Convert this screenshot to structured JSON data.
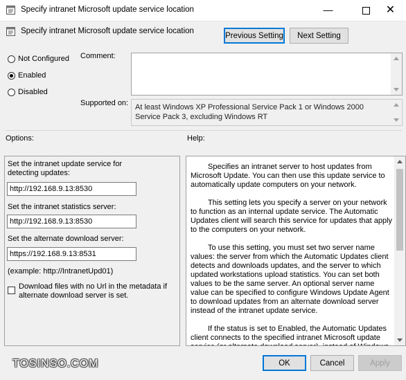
{
  "window": {
    "title": "Specify intranet Microsoft update service location",
    "minimize_icon": "minimize-icon",
    "maximize_icon": "maximize-icon",
    "close_icon": "close-icon"
  },
  "header": {
    "title": "Specify intranet Microsoft update service location",
    "previous_setting": "Previous Setting",
    "next_setting": "Next Setting"
  },
  "state": {
    "options": [
      {
        "label": "Not Configured",
        "checked": false
      },
      {
        "label": "Enabled",
        "checked": true
      },
      {
        "label": "Disabled",
        "checked": false
      }
    ]
  },
  "comment": {
    "label": "Comment:",
    "value": ""
  },
  "supported_on": {
    "label": "Supported on:",
    "value": "At least Windows XP Professional Service Pack 1 or Windows 2000 Service Pack 3, excluding Windows RT"
  },
  "options_section": {
    "label": "Options:",
    "detect_label": "Set the intranet update service for detecting updates:",
    "detect_value": "http://192.168.9.13:8530",
    "stats_label": "Set the intranet statistics server:",
    "stats_value": "http://192.168.9.13:8530",
    "alt_label": "Set the alternate download server:",
    "alt_value": "https://192.168.9.13:8531",
    "example": "(example: http://IntranetUpd01)",
    "checkbox_label": "Download files with no Url in the metadata if alternate download server is set.",
    "checkbox_checked": false
  },
  "help_section": {
    "label": "Help:",
    "paragraphs": [
      "Specifies an intranet server to host updates from Microsoft Update. You can then use this update service to automatically update computers on your network.",
      "This setting lets you specify a server on your network to function as an internal update service. The Automatic Updates client will search this service for updates that apply to the computers on your network.",
      "To use this setting, you must set two server name values: the server from which the Automatic Updates client detects and downloads updates, and the server to which updated workstations upload statistics. You can set both values to be the same server. An optional server name value can be specified to configure Windows Update Agent to download updates from an alternate download server instead of the intranet update service.",
      "If the status is set to Enabled, the Automatic Updates client connects to the specified intranet Microsoft update service (or alternate download server), instead of Windows Update, to"
    ]
  },
  "footer": {
    "ok": "OK",
    "cancel": "Cancel",
    "apply": "Apply"
  },
  "watermark": "TOSINSO.COM",
  "colors": {
    "background": "#f0f0f0",
    "accent": "#0078d7"
  }
}
